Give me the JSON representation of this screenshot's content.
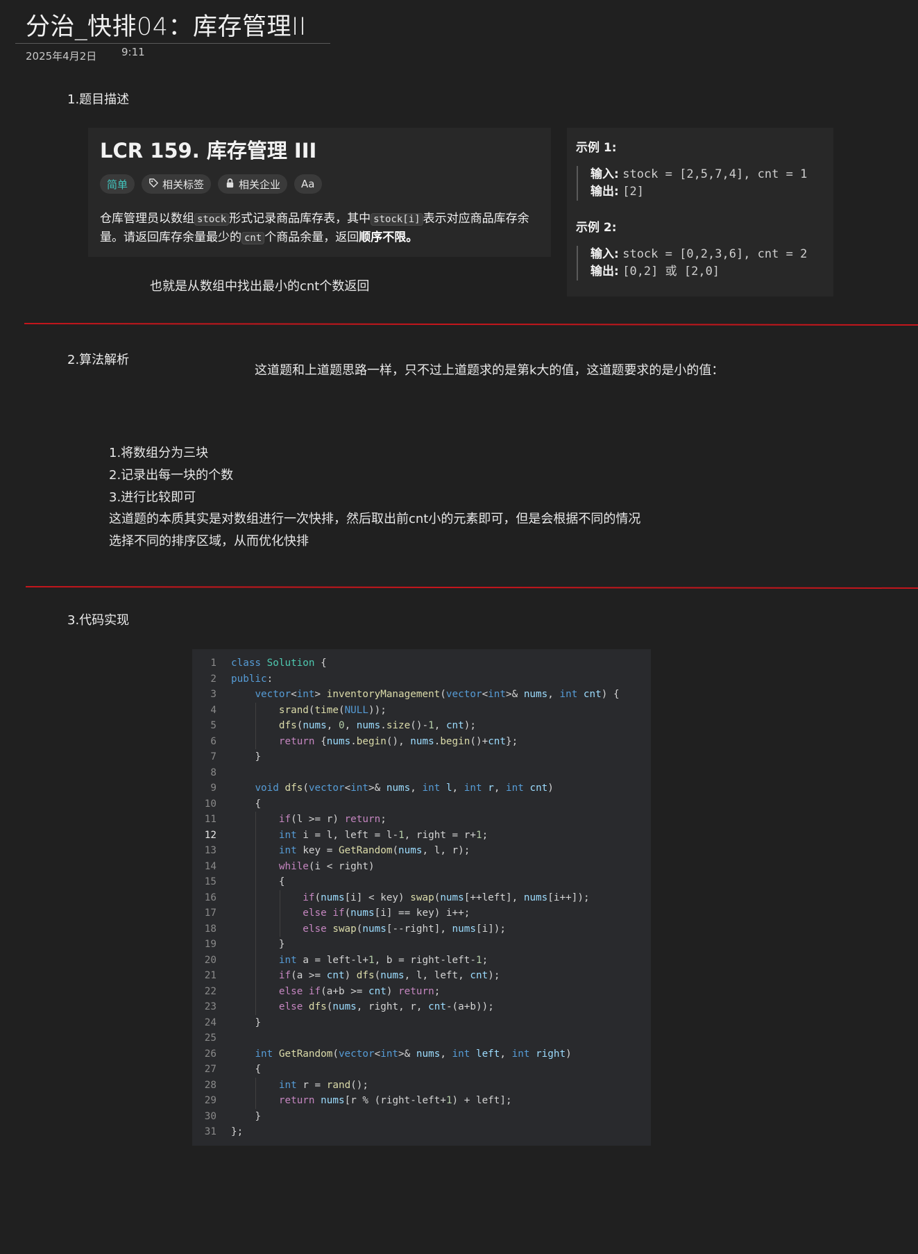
{
  "page": {
    "title": "分治_快排04：库存管理II",
    "date": "2025年4月2日",
    "time": "9:11"
  },
  "section1": {
    "heading": "1.题目描述",
    "problem": {
      "title": "LCR 159. 库存管理 III",
      "tags": [
        "简单",
        "相关标签",
        "相关企业",
        "Aa"
      ],
      "desc_1": "仓库管理员以数组",
      "desc_code_1": "stock",
      "desc_2": "形式记录商品库存表，其中",
      "desc_code_2": "stock[i]",
      "desc_3": "表示对应商品库存余量。请返回库存余量最少的",
      "desc_code_3": "cnt",
      "desc_4": "个商品余量，返回",
      "desc_bold": "顺序不限。"
    },
    "examples": [
      {
        "title": "示例 1:",
        "input_label": "输入:",
        "input": "stock = [2,5,7,4], cnt = 1",
        "output_label": "输出:",
        "output": "[2]"
      },
      {
        "title": "示例 2:",
        "input_label": "输入:",
        "input": "stock = [0,2,3,6], cnt = 2",
        "output_label": "输出:",
        "output": "[0,2] 或 [2,0]"
      }
    ],
    "note": "也就是从数组中找出最小的cnt个数返回"
  },
  "section2": {
    "heading": "2.算法解析",
    "intro": "这道题和上道题思路一样，只不过上道题求的是第k大的值，这道题要求的是小的值：",
    "lines": [
      "1.将数组分为三块",
      "2.记录出每一块的个数",
      "3.进行比较即可",
      "这道题的本质其实是对数组进行一次快排，然后取出前cnt小的元素即可，但是会根据不同的情况",
      "选择不同的排序区域，从而优化快排"
    ]
  },
  "section3": {
    "heading": "3.代码实现",
    "active_line": 12,
    "code": [
      "class Solution {",
      "public:",
      "    vector<int> inventoryManagement(vector<int>& nums, int cnt) {",
      "        srand(time(NULL));",
      "        dfs(nums, 0, nums.size()-1, cnt);",
      "        return {nums.begin(), nums.begin()+cnt};",
      "    }",
      "",
      "    void dfs(vector<int>& nums, int l, int r, int cnt)",
      "    {",
      "        if(l >= r) return;",
      "        int i = l, left = l-1, right = r+1;",
      "        int key = GetRandom(nums, l, r);",
      "        while(i < right)",
      "        {",
      "            if(nums[i] < key) swap(nums[++left], nums[i++]);",
      "            else if(nums[i] == key) i++;",
      "            else swap(nums[--right], nums[i]);",
      "        }",
      "        int a = left-l+1, b = right-left-1;",
      "        if(a >= cnt) dfs(nums, l, left, cnt);",
      "        else if(a+b >= cnt) return;",
      "        else dfs(nums, right, r, cnt-(a+b));",
      "    }",
      "",
      "    int GetRandom(vector<int>& nums, int left, int right)",
      "    {",
      "        int r = rand();",
      "        return nums[r % (right-left+1) + left];",
      "    }",
      "};"
    ]
  },
  "colors": {
    "background": "#202020",
    "divider": "#c4161c",
    "easy_tag": "#41c4bd"
  }
}
